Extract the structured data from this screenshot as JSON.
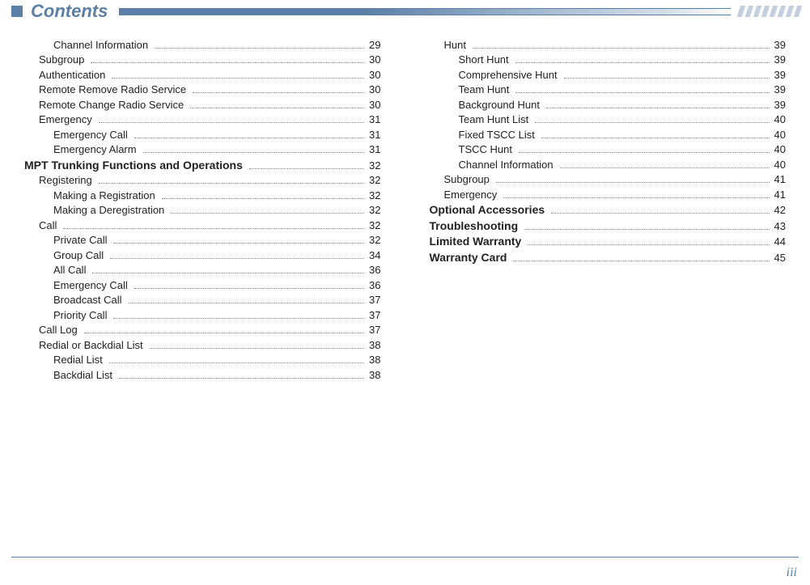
{
  "header": {
    "title": "Contents"
  },
  "pageNumber": "iii",
  "leftColumn": [
    {
      "label": "Channel Information",
      "page": "29",
      "indent": 2,
      "bold": false
    },
    {
      "label": "Subgroup",
      "page": "30",
      "indent": 1,
      "bold": false
    },
    {
      "label": "Authentication",
      "page": "30",
      "indent": 1,
      "bold": false
    },
    {
      "label": "Remote Remove Radio Service",
      "page": "30",
      "indent": 1,
      "bold": false
    },
    {
      "label": "Remote Change Radio Service",
      "page": "30",
      "indent": 1,
      "bold": false
    },
    {
      "label": "Emergency",
      "page": "31",
      "indent": 1,
      "bold": false
    },
    {
      "label": "Emergency Call",
      "page": "31",
      "indent": 2,
      "bold": false
    },
    {
      "label": "Emergency Alarm",
      "page": "31",
      "indent": 2,
      "bold": false
    },
    {
      "label": "MPT Trunking Functions and Operations",
      "page": "32",
      "indent": 0,
      "bold": true
    },
    {
      "label": "Registering",
      "page": "32",
      "indent": 1,
      "bold": false
    },
    {
      "label": "Making a Registration",
      "page": "32",
      "indent": 2,
      "bold": false
    },
    {
      "label": "Making a Deregistration",
      "page": "32",
      "indent": 2,
      "bold": false
    },
    {
      "label": "Call",
      "page": "32",
      "indent": 1,
      "bold": false
    },
    {
      "label": "Private Call",
      "page": "32",
      "indent": 2,
      "bold": false
    },
    {
      "label": "Group Call",
      "page": "34",
      "indent": 2,
      "bold": false
    },
    {
      "label": "All Call",
      "page": "36",
      "indent": 2,
      "bold": false
    },
    {
      "label": "Emergency Call",
      "page": "36",
      "indent": 2,
      "bold": false
    },
    {
      "label": "Broadcast Call",
      "page": "37",
      "indent": 2,
      "bold": false
    },
    {
      "label": "Priority Call",
      "page": "37",
      "indent": 2,
      "bold": false
    },
    {
      "label": "Call Log",
      "page": "37",
      "indent": 1,
      "bold": false
    },
    {
      "label": "Redial or Backdial List",
      "page": "38",
      "indent": 1,
      "bold": false
    },
    {
      "label": "Redial List",
      "page": "38",
      "indent": 2,
      "bold": false
    },
    {
      "label": "Backdial List",
      "page": "38",
      "indent": 2,
      "bold": false
    }
  ],
  "rightColumn": [
    {
      "label": "Hunt",
      "page": "39",
      "indent": 1,
      "bold": false
    },
    {
      "label": "Short Hunt",
      "page": "39",
      "indent": 2,
      "bold": false
    },
    {
      "label": "Comprehensive Hunt",
      "page": "39",
      "indent": 2,
      "bold": false
    },
    {
      "label": "Team Hunt",
      "page": "39",
      "indent": 2,
      "bold": false
    },
    {
      "label": "Background Hunt",
      "page": "39",
      "indent": 2,
      "bold": false
    },
    {
      "label": "Team Hunt List",
      "page": "40",
      "indent": 2,
      "bold": false
    },
    {
      "label": "Fixed TSCC List",
      "page": "40",
      "indent": 2,
      "bold": false
    },
    {
      "label": "TSCC Hunt",
      "page": "40",
      "indent": 2,
      "bold": false
    },
    {
      "label": "Channel Information",
      "page": "40",
      "indent": 2,
      "bold": false
    },
    {
      "label": "Subgroup",
      "page": "41",
      "indent": 1,
      "bold": false
    },
    {
      "label": "Emergency",
      "page": "41",
      "indent": 1,
      "bold": false
    },
    {
      "label": "Optional Accessories",
      "page": "42",
      "indent": 0,
      "bold": true
    },
    {
      "label": "Troubleshooting",
      "page": "43",
      "indent": 0,
      "bold": true
    },
    {
      "label": "Limited Warranty",
      "page": "44",
      "indent": 0,
      "bold": true
    },
    {
      "label": "Warranty Card",
      "page": "45",
      "indent": 0,
      "bold": true
    }
  ]
}
